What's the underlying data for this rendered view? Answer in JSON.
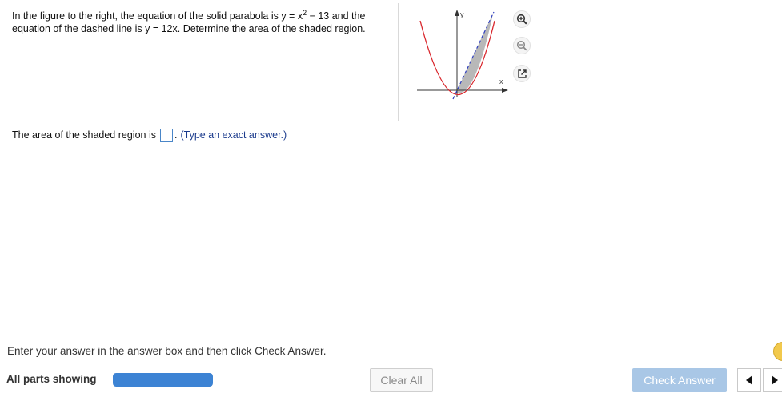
{
  "question": {
    "text_part1": "In the figure to the right, the equation of the solid parabola is y = x",
    "exponent": "2",
    "text_part2": " − 13 and the equation of the dashed line is y = 12x. Determine the area of the shaded region."
  },
  "figure": {
    "y_label": "y",
    "x_label": "x",
    "colors": {
      "parabola": "#d9262c",
      "line": "#2f3fbf",
      "shade": "#b8b8b8"
    }
  },
  "tools": {
    "zoom_in": "zoom-in-icon",
    "zoom_out": "zoom-out-icon",
    "popout": "popout-icon"
  },
  "answer": {
    "prefix": "The area of the shaded region is",
    "suffix": ".",
    "hint": "(Type an exact answer.)",
    "value": ""
  },
  "instruction": "Enter your answer in the answer box and then click Check Answer.",
  "footer": {
    "parts_label": "All parts showing",
    "progress": 1.0,
    "clear_label": "Clear All",
    "check_label": "Check Answer"
  },
  "colors": {
    "accent": "#3c83d4",
    "check_button": "#a9c7e6",
    "answer_border": "#4a86c8"
  }
}
